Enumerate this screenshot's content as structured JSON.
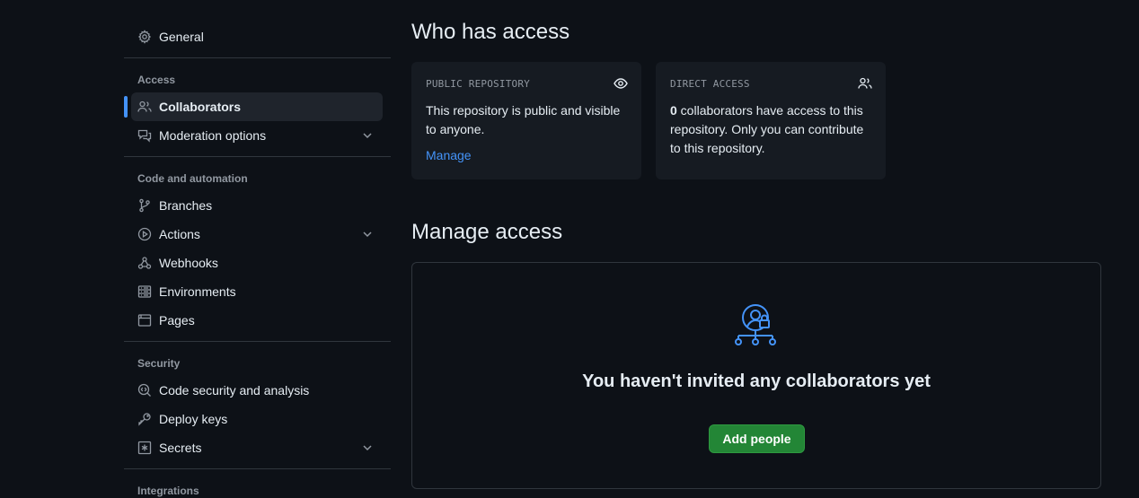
{
  "sidebar": {
    "general": "General",
    "groups": {
      "access": "Access",
      "code_automation": "Code and automation",
      "security": "Security",
      "integrations": "Integrations"
    },
    "items": {
      "collaborators": "Collaborators",
      "moderation": "Moderation options",
      "branches": "Branches",
      "actions": "Actions",
      "webhooks": "Webhooks",
      "environments": "Environments",
      "pages": "Pages",
      "code_security": "Code security and analysis",
      "deploy_keys": "Deploy keys",
      "secrets": "Secrets"
    }
  },
  "main": {
    "who_title": "Who has access",
    "public_card": {
      "label": "PUBLIC REPOSITORY",
      "text": "This repository is public and visible to anyone.",
      "link": "Manage"
    },
    "direct_card": {
      "label": "DIRECT ACCESS",
      "count": "0",
      "text": " collaborators have access to this repository. Only you can contribute to this repository."
    },
    "manage_title": "Manage access",
    "empty_title": "You haven't invited any collaborators yet",
    "add_button": "Add people"
  },
  "colors": {
    "background": "#0d1117",
    "accent": "#4493f8",
    "button": "#238636"
  }
}
